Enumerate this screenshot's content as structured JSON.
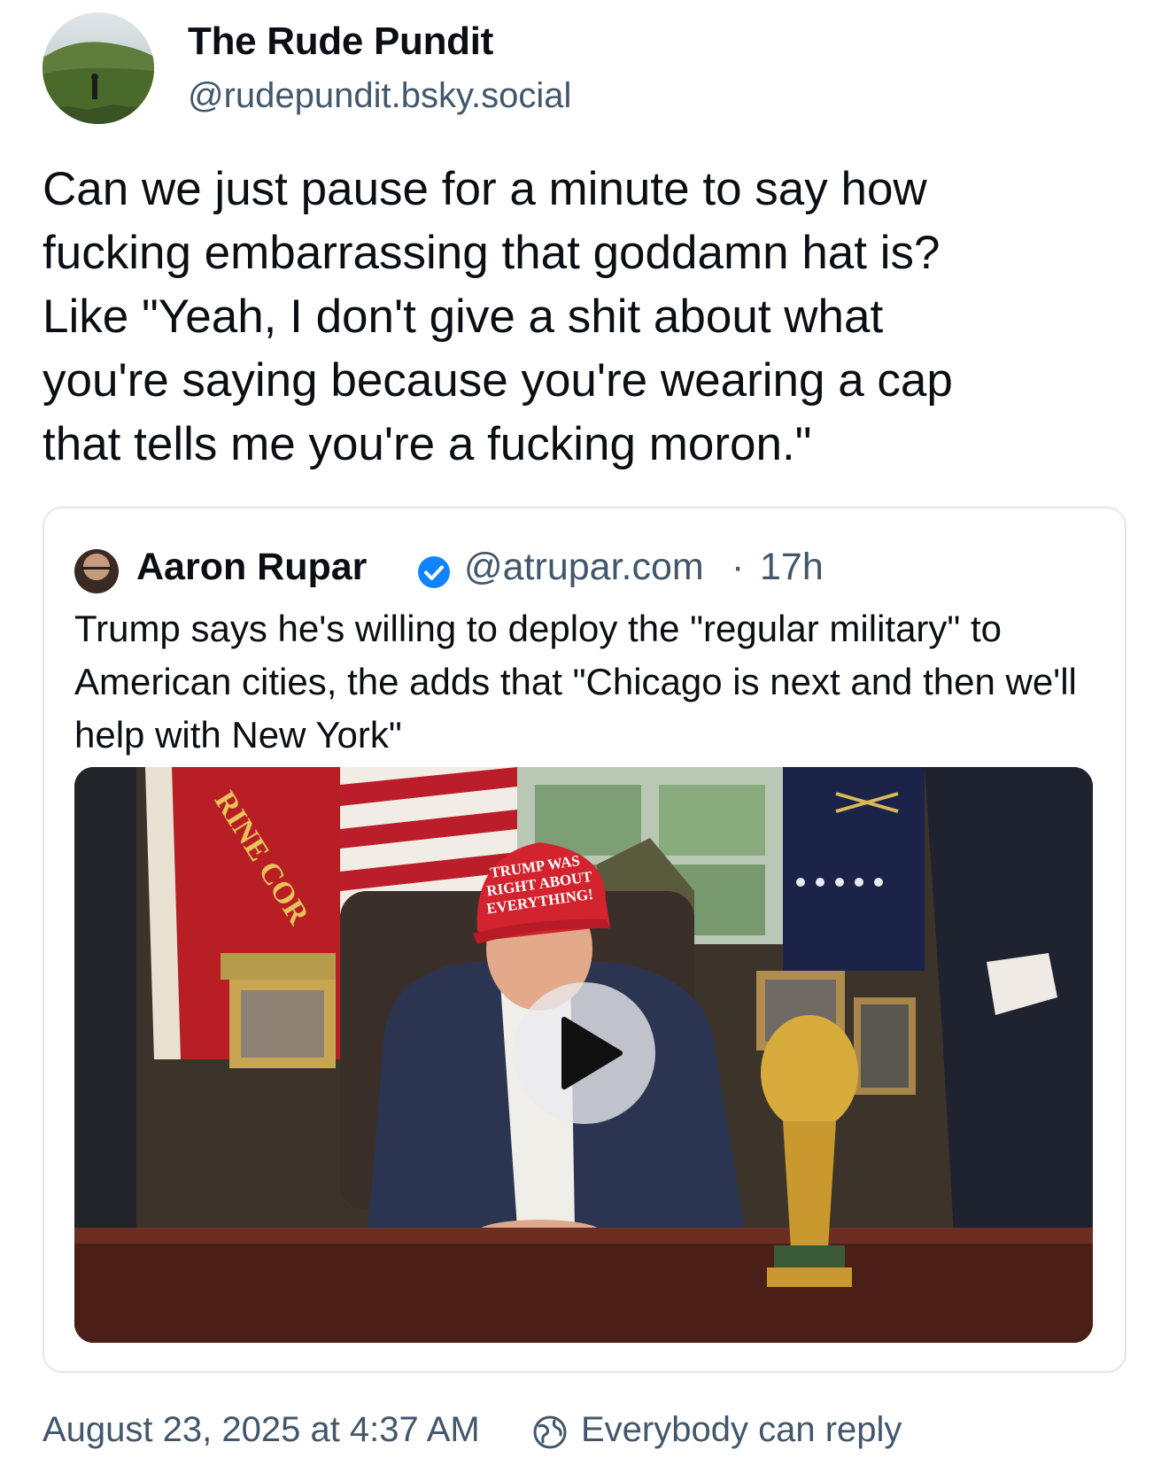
{
  "post": {
    "author": {
      "display_name": "The Rude Pundit",
      "handle": "@rudepundit.bsky.social",
      "avatar_icon": "profile-photo-landscape"
    },
    "text": "Can we just pause for a minute to say how\nfucking embarrassing that goddamn hat is?\nLike \"Yeah, I don't give a shit about what\nyou're saying because you're wearing a cap\nthat tells me you're a fucking moron.\"",
    "timestamp": "August 23, 2025 at 4:37 AM",
    "reply_setting": "Everybody can reply"
  },
  "quote": {
    "author": {
      "display_name": "Aaron Rupar",
      "handle": "@atrupar.com",
      "separator": "·",
      "time_ago": "17h",
      "verified": true
    },
    "text": "Trump says he's willing to deploy the \"regular military\" to American cities, the adds that \"Chicago is next and then we'll help with New York\"",
    "video": {
      "hat_text_line1": "TRUMP WAS",
      "hat_text_line2": "RIGHT ABOUT",
      "hat_text_line3": "EVERYTHING!",
      "flag_text": "RINE COR",
      "play_icon": "play-icon"
    }
  },
  "colors": {
    "text_primary": "#0b0f14",
    "text_secondary": "#42576c",
    "verified_blue": "#1083fe",
    "card_border": "#e2e7ee"
  }
}
